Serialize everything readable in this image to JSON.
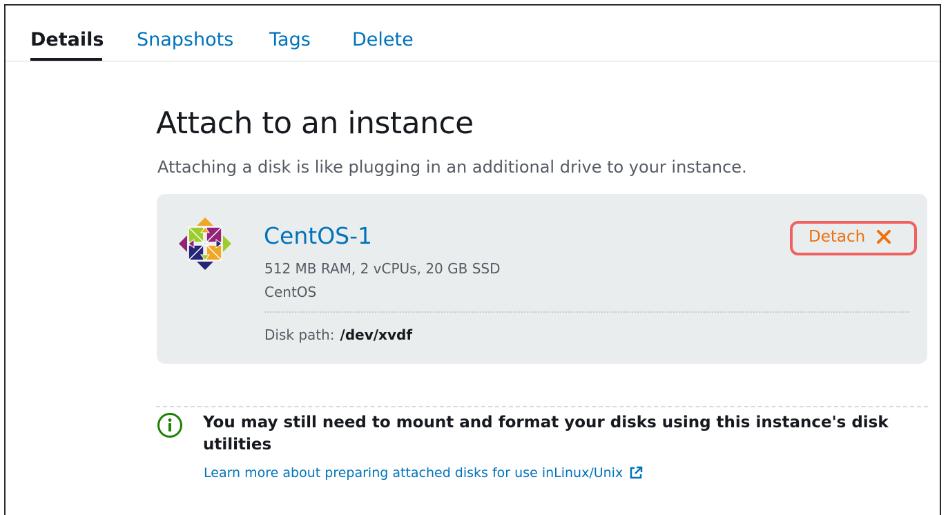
{
  "tabs": [
    {
      "label": "Details",
      "active": true
    },
    {
      "label": "Snapshots",
      "active": false
    },
    {
      "label": "Tags",
      "active": false
    },
    {
      "label": "Delete",
      "active": false
    }
  ],
  "section": {
    "title": "Attach to an instance",
    "description": "Attaching a disk is like plugging in an additional drive to your instance."
  },
  "instance": {
    "name": "CentOS-1",
    "specs": "512 MB RAM, 2 vCPUs, 20 GB SSD",
    "os": "CentOS",
    "disk_path_label": "Disk path:",
    "disk_path_value": "/dev/xvdf",
    "logo_icon": "centos-logo-icon"
  },
  "detach": {
    "label": "Detach",
    "icon": "close-icon"
  },
  "alert": {
    "icon": "info-icon",
    "text": "You may still need to mount and format your disks using this instance's disk utilities",
    "link_text": "Learn more about preparing attached disks for use inLinux/Unix",
    "link_icon": "external-link-icon"
  },
  "colors": {
    "link": "#0073bb",
    "accent_orange": "#ec7211",
    "highlight_red": "#ef6061",
    "info_green": "#1d8102",
    "card_bg": "#eaeded"
  }
}
